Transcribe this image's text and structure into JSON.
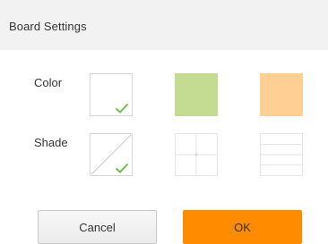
{
  "dialog": {
    "title": "Board Settings"
  },
  "color_row": {
    "label": "Color",
    "options": [
      {
        "name": "white",
        "hex": "#ffffff",
        "selected": true
      },
      {
        "name": "green",
        "hex": "#c3dc92",
        "selected": false
      },
      {
        "name": "orange",
        "hex": "#ffcf94",
        "selected": false
      }
    ]
  },
  "shade_row": {
    "label": "Shade",
    "options": [
      {
        "name": "diagonal",
        "selected": true
      },
      {
        "name": "grid",
        "selected": false
      },
      {
        "name": "lines",
        "selected": false
      }
    ]
  },
  "colors": {
    "check": "#6cbf4b",
    "accent": "#ff8c00"
  },
  "buttons": {
    "cancel_label": "Cancel",
    "ok_label": "OK"
  }
}
